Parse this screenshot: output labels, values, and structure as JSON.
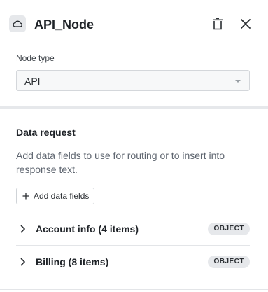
{
  "panel": {
    "title": "API_Node",
    "node_icon": "cloud-icon",
    "actions": {
      "delete_icon": "trash-icon",
      "close_icon": "close-icon"
    }
  },
  "node_type": {
    "label": "Node type",
    "selected": "API"
  },
  "data_request": {
    "title": "Data request",
    "description": "Add data fields to use for routing or to insert into response text.",
    "add_button_label": "Add data fields",
    "groups": [
      {
        "label": "Account info (4 items)",
        "badge": "OBJECT"
      },
      {
        "label": "Billing (8 items)",
        "badge": "OBJECT"
      }
    ]
  },
  "colors": {
    "badge_bg": "#e6e8eb",
    "divider": "#e6e8eb"
  }
}
